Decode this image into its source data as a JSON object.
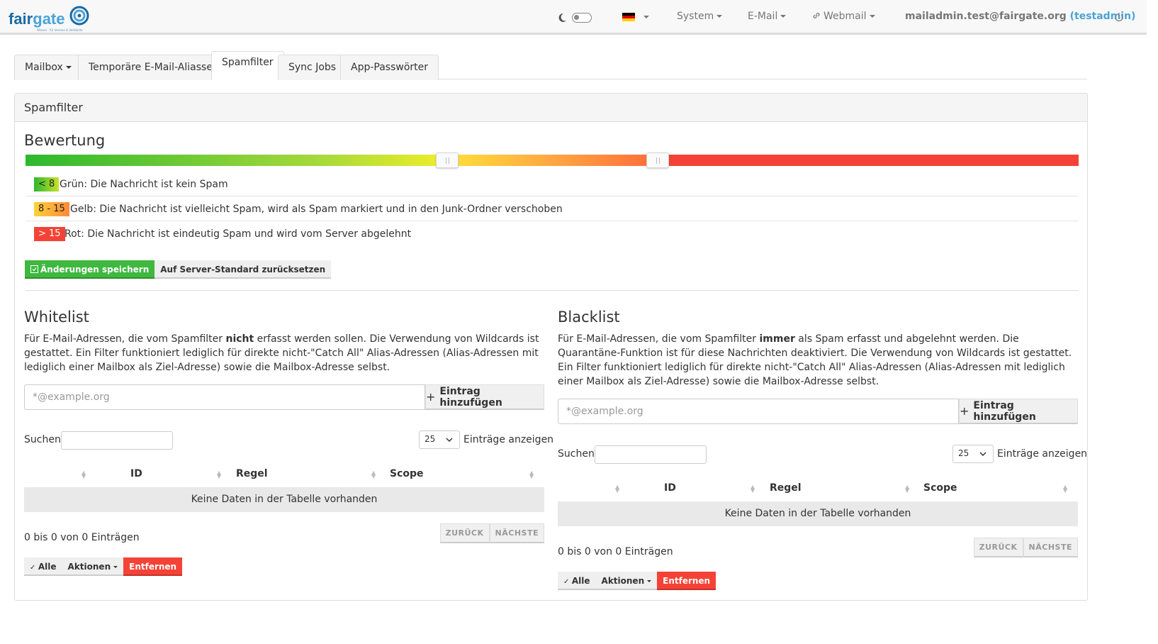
{
  "brand": {
    "name_a": "fair",
    "name_b": "gate",
    "tagline": "Wissen · für Vereine & Verbände"
  },
  "nav": {
    "system": "System",
    "email": "E-Mail",
    "webmail": "Webmail",
    "user_email": "mailadmin.test@fairgate.org",
    "user_name": "(testadmin)"
  },
  "tabs": [
    {
      "label": "Mailbox"
    },
    {
      "label": "Temporäre E-Mail-Aliasse"
    },
    {
      "label": "Spamfilter"
    },
    {
      "label": "Sync Jobs"
    },
    {
      "label": "App-Passwörter"
    }
  ],
  "panel": {
    "title": "Spamfilter"
  },
  "rating": {
    "title": "Bewertung",
    "green_max": 8,
    "red_min": 15,
    "legend": [
      {
        "badge": "< 8",
        "text": "Grün: Die Nachricht ist kein Spam"
      },
      {
        "badge": "8 - 15",
        "text": "Gelb: Die Nachricht ist vielleicht Spam, wird als Spam markiert und in den Junk-Ordner verschoben"
      },
      {
        "badge": "> 15",
        "text": "Rot: Die Nachricht ist eindeutig Spam und wird vom Server abgelehnt"
      }
    ],
    "save_label": "Änderungen speichern",
    "reset_label": "Auf Server-Standard zurücksetzen"
  },
  "whitelist": {
    "title": "Whitelist",
    "desc_a": "Für E-Mail-Adressen, die vom Spamfilter ",
    "desc_b": "nicht",
    "desc_c": " erfasst werden sollen. Die Verwendung von Wildcards ist gestattet. Ein Filter funktioniert lediglich für direkte nicht-\"Catch All\" Alias-Adressen (Alias-Adressen mit lediglich einer Mailbox als Ziel-Adresse) sowie die Mailbox-Adresse selbst.",
    "placeholder": "*@example.org",
    "add_label": "Eintrag hinzufügen"
  },
  "blacklist": {
    "title": "Blacklist",
    "desc_a": "Für E-Mail-Adressen, die vom Spamfilter ",
    "desc_b": "immer",
    "desc_c": " als Spam erfasst und abgelehnt werden. Die Quarantäne-Funktion ist für diese Nachrichten deaktiviert. Die Verwendung von Wildcards ist gestattet. Ein Filter funktioniert lediglich für direkte nicht-\"Catch All\" Alias-Adressen (Alias-Adressen mit lediglich einer Mailbox als Ziel-Adresse) sowie die Mailbox-Adresse selbst.",
    "placeholder": "*@example.org",
    "add_label": "Eintrag hinzufügen"
  },
  "table": {
    "search_label": "Suchen",
    "page_size": "25",
    "show_label": "Einträge anzeigen",
    "col_id": "ID",
    "col_rule": "Regel",
    "col_scope": "Scope",
    "empty": "Keine Daten in der Tabelle vorhanden",
    "info": "0 bis 0 von 0 Einträgen",
    "prev": "ZURÜCK",
    "next": "NÄCHSTE",
    "all": "Alle",
    "actions": "Aktionen",
    "remove": "Entfernen"
  },
  "colors": {
    "green": "#3fb83f",
    "red": "#f44336",
    "accent": "#4aa3d6"
  }
}
